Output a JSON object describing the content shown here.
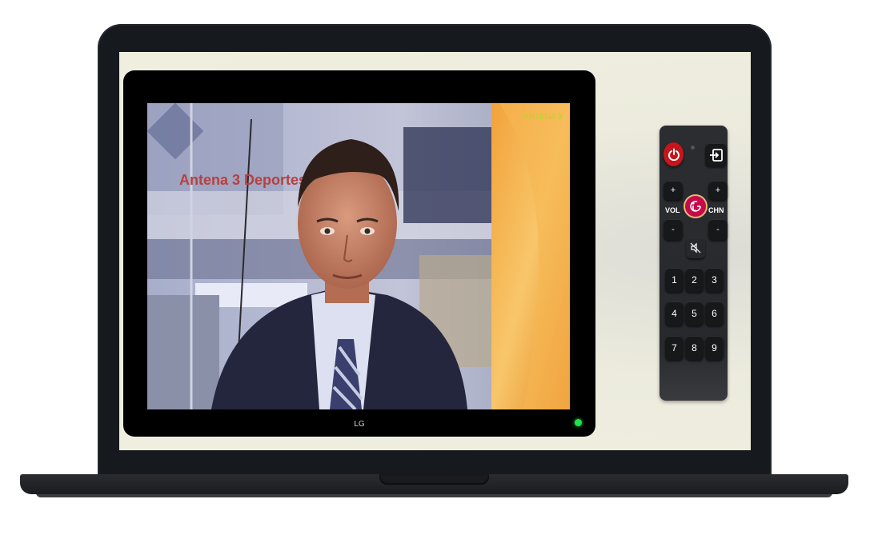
{
  "tv": {
    "brand": "LG",
    "status_led_color": "#22e04a",
    "picture": {
      "channel_logo": "ANTENA 3",
      "studio_sign": "Antena 3 Deportes"
    }
  },
  "remote": {
    "power_icon": "power-icon",
    "input_icon": "input-icon",
    "vol_label": "VOL",
    "chn_label": "CHN",
    "vol_up": "+",
    "vol_down": "-",
    "chn_up": "+",
    "chn_down": "-",
    "mute_icon": "mute-icon",
    "logo_icon": "lg-logo-icon",
    "digits": [
      "1",
      "2",
      "3",
      "4",
      "5",
      "6",
      "7",
      "8",
      "9"
    ]
  },
  "colors": {
    "power": "#c4161c",
    "lg_brand": "#c7094a",
    "laptop_frame": "#16191e",
    "screen_bg": "#f0efdf"
  }
}
